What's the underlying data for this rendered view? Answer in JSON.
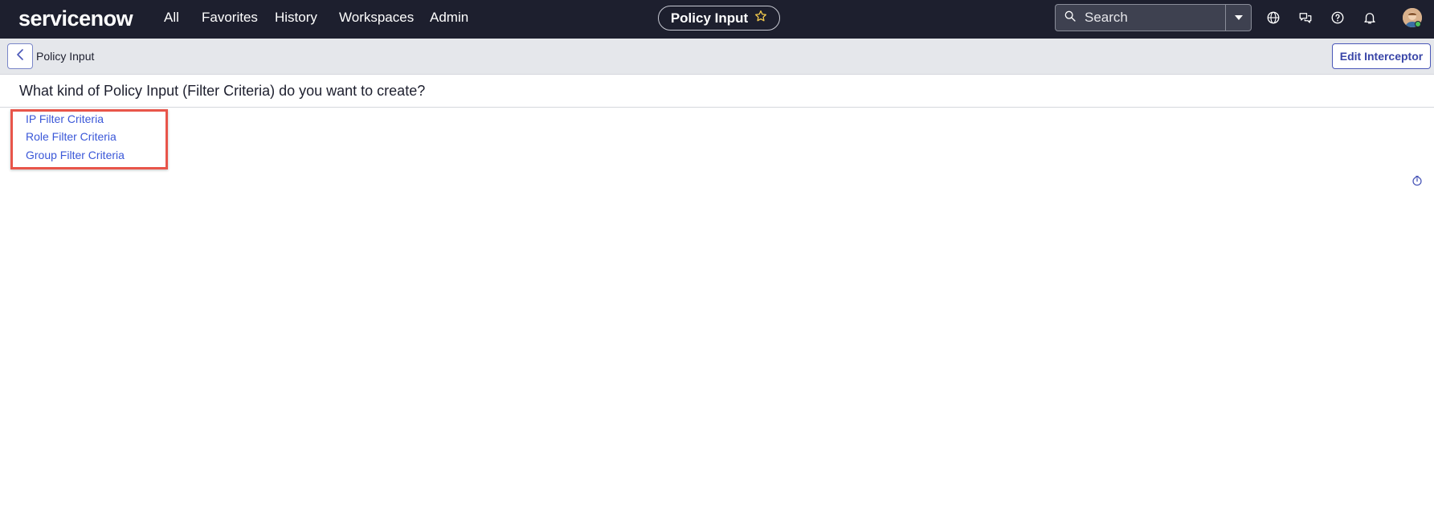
{
  "nav": {
    "logo": "servicenow",
    "links": [
      "All",
      "Favorites",
      "History",
      "Workspaces",
      "Admin"
    ],
    "context_pill": {
      "title": "Policy Input",
      "icon": "star-outline-icon"
    },
    "search": {
      "placeholder": "Search"
    },
    "icons": [
      "globe-icon",
      "chat-icon",
      "help-icon",
      "bell-icon"
    ]
  },
  "header": {
    "title": "Policy Input",
    "back_icon": "chevron-left-icon",
    "edit_button": "Edit Interceptor"
  },
  "main": {
    "question": "What kind of Policy Input (Filter Criteria) do you want to create?",
    "options": [
      "IP Filter Criteria",
      "Role Filter Criteria",
      "Group Filter Criteria"
    ]
  },
  "colors": {
    "nav_bg": "#1d1f2e",
    "link": "#3a57d8",
    "highlight": "#e8554a",
    "header_bg": "#e5e7eb"
  }
}
